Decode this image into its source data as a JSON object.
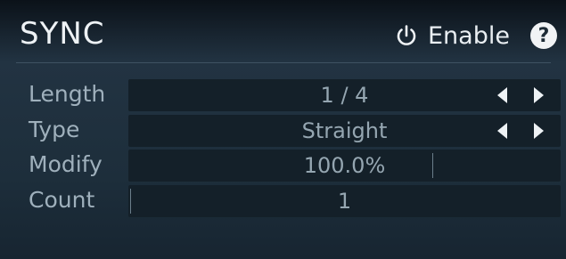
{
  "header": {
    "title": "SYNC",
    "enable_label": "Enable",
    "enable_icon": "power-icon",
    "help_label": "?",
    "help_icon": "help-icon"
  },
  "params": {
    "length": {
      "label": "Length",
      "value": "1 / 4"
    },
    "type": {
      "label": "Type",
      "value": "Straight"
    },
    "modify": {
      "label": "Modify",
      "value": "100.0%"
    },
    "count": {
      "label": "Count",
      "value": "1"
    }
  },
  "colors": {
    "background": "#1d2e3b",
    "field": "#142029",
    "label_text": "#9fb0bc",
    "title_text": "#eef2f5"
  }
}
